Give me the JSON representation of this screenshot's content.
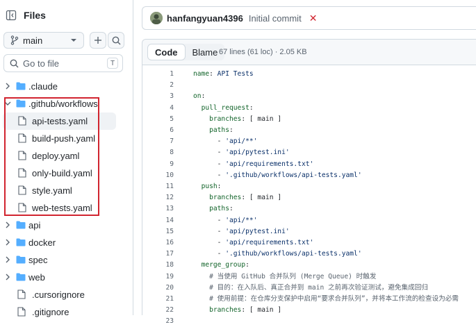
{
  "sidebar": {
    "title": "Files",
    "branch": "main",
    "goto_placeholder": "Go to file",
    "goto_shortcut": "T",
    "items": [
      {
        "label": ".claude",
        "type": "folder",
        "level": 0,
        "expanded": false
      },
      {
        "label": ".github/workflows",
        "type": "folder",
        "level": 0,
        "expanded": true
      },
      {
        "label": "api-tests.yaml",
        "type": "file",
        "level": 1,
        "selected": true
      },
      {
        "label": "build-push.yaml",
        "type": "file",
        "level": 1
      },
      {
        "label": "deploy.yaml",
        "type": "file",
        "level": 1
      },
      {
        "label": "only-build.yaml",
        "type": "file",
        "level": 1
      },
      {
        "label": "style.yaml",
        "type": "file",
        "level": 1
      },
      {
        "label": "web-tests.yaml",
        "type": "file",
        "level": 1
      },
      {
        "label": "api",
        "type": "folder",
        "level": 0,
        "expanded": false
      },
      {
        "label": "docker",
        "type": "folder",
        "level": 0,
        "expanded": false
      },
      {
        "label": "spec",
        "type": "folder",
        "level": 0,
        "expanded": false
      },
      {
        "label": "web",
        "type": "folder",
        "level": 0,
        "expanded": false
      },
      {
        "label": ".cursorignore",
        "type": "file",
        "level": 0
      },
      {
        "label": ".gitignore",
        "type": "file",
        "level": 0
      }
    ]
  },
  "commit": {
    "author": "hanfangyuan4396",
    "message": "Initial commit",
    "status_mark": "✕"
  },
  "code": {
    "tabs": [
      "Code",
      "Blame"
    ],
    "active_tab": "Code",
    "meta": "67 lines (61 loc) · 2.05 KB",
    "lines": [
      {
        "n": "1",
        "text": "name: API Tests"
      },
      {
        "n": "2",
        "text": ""
      },
      {
        "n": "3",
        "text": "on:"
      },
      {
        "n": "4",
        "text": "  pull_request:"
      },
      {
        "n": "5",
        "text": "    branches: [ main ]"
      },
      {
        "n": "6",
        "text": "    paths:"
      },
      {
        "n": "7",
        "text": "      - 'api/**'"
      },
      {
        "n": "8",
        "text": "      - 'api/pytest.ini'"
      },
      {
        "n": "9",
        "text": "      - 'api/requirements.txt'"
      },
      {
        "n": "10",
        "text": "      - '.github/workflows/api-tests.yaml'"
      },
      {
        "n": "11",
        "text": "  push:"
      },
      {
        "n": "12",
        "text": "    branches: [ main ]"
      },
      {
        "n": "13",
        "text": "    paths:"
      },
      {
        "n": "14",
        "text": "      - 'api/**'"
      },
      {
        "n": "15",
        "text": "      - 'api/pytest.ini'"
      },
      {
        "n": "16",
        "text": "      - 'api/requirements.txt'"
      },
      {
        "n": "17",
        "text": "      - '.github/workflows/api-tests.yaml'"
      },
      {
        "n": "18",
        "text": "  merge_group:"
      },
      {
        "n": "19",
        "text": "    # 当使用 GitHub 合并队列 (Merge Queue) 时触发"
      },
      {
        "n": "20",
        "text": "    # 目的：在入队后、真正合并到 main 之前再次验证测试，避免集成回归"
      },
      {
        "n": "21",
        "text": "    # 使用前提：在仓库分支保护中启用“要求合并队列”，并将本工作流的检查设为必需"
      },
      {
        "n": "22",
        "text": "    branches: [ main ]"
      },
      {
        "n": "23",
        "text": ""
      }
    ]
  }
}
